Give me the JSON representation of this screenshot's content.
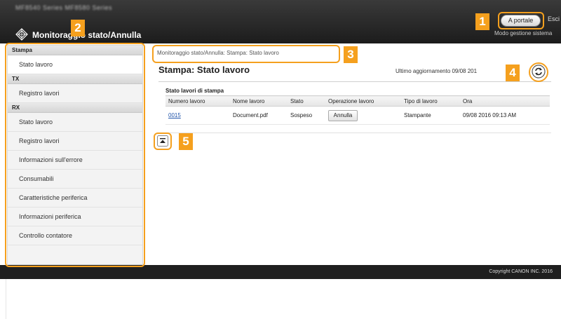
{
  "header": {
    "model_text": "MF8540 Series MF8580 Series",
    "app_title": "Monitoraggio stato/Annulla",
    "portal_button": "A portale",
    "logout": "Esci",
    "system_manager": "Modo gestione sistema"
  },
  "sidebar": {
    "sections": [
      {
        "header": "Stampa",
        "items": [
          {
            "label": "Stato lavoro",
            "selected": true
          }
        ]
      },
      {
        "header": "TX",
        "items": [
          {
            "label": "Registro lavori"
          }
        ]
      },
      {
        "header": "RX",
        "items": [
          {
            "label": "Stato lavoro"
          },
          {
            "label": "Registro lavori"
          }
        ]
      },
      {
        "header": "",
        "items": [
          {
            "label": "Informazioni sull'errore"
          },
          {
            "label": "Consumabili"
          },
          {
            "label": "Caratteristiche periferica"
          },
          {
            "label": "Informazioni periferica"
          },
          {
            "label": "Controllo contatore"
          }
        ]
      }
    ]
  },
  "main": {
    "breadcrumb": "Monitoraggio stato/Annulla: Stampa: Stato lavoro",
    "title": "Stampa: Stato lavoro",
    "last_update": "Ultimo aggiornamento 09/08 201",
    "table": {
      "caption": "Stato lavori di stampa",
      "columns": [
        "Numero lavoro",
        "Nome lavoro",
        "Stato",
        "Operazione lavoro",
        "Tipo di lavoro",
        "Ora"
      ],
      "rows": [
        {
          "number": "0015",
          "name": "Document.pdf",
          "status": "Sospeso",
          "operation": "Annulla",
          "type": "Stampante",
          "time": "09/08 2016 09:13 AM"
        }
      ]
    }
  },
  "footer": {
    "copyright": "Copyright CANON INC. 2016"
  },
  "callouts": [
    "1",
    "2",
    "3",
    "4",
    "5"
  ],
  "colors": {
    "callout": "#f5a01e",
    "header_bg": "#2b2b2b",
    "footer_bg": "#1f1f1f",
    "link": "#2255aa"
  },
  "icons": {
    "logo": "canon-diamond-logo",
    "refresh": "refresh-icon",
    "back_to_top": "back-to-top-icon"
  }
}
